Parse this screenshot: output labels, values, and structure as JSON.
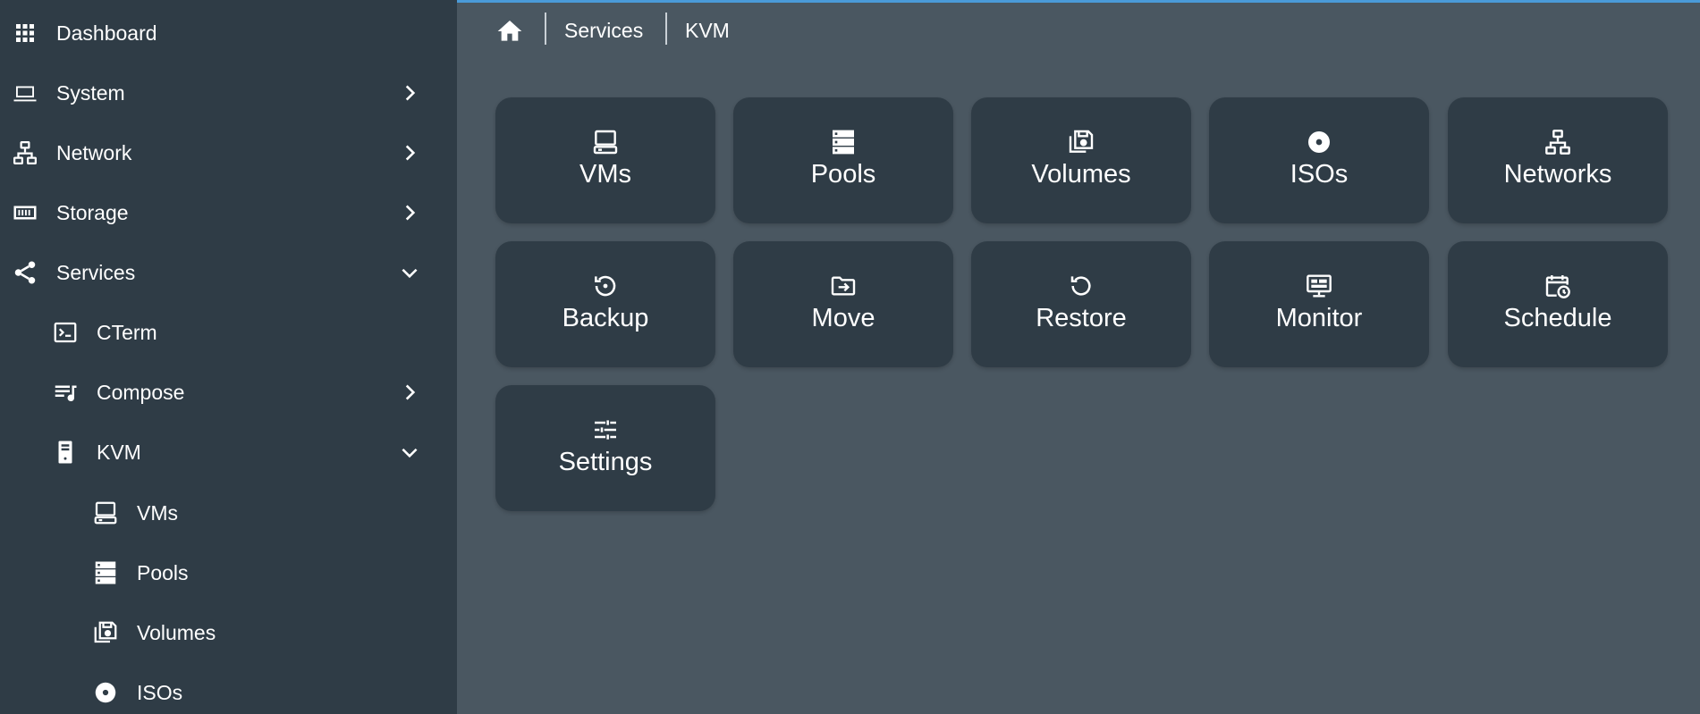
{
  "colors": {
    "sidebar_bg": "#2f3c46",
    "main_bg": "#4a5761",
    "tile_bg": "#2f3c46",
    "accent_line": "#4a9ad8",
    "text": "#ffffff"
  },
  "sidebar": {
    "items": [
      {
        "label": "Dashboard",
        "icon": "apps-grid-icon"
      },
      {
        "label": "System",
        "icon": "laptop-icon",
        "chevron": "right"
      },
      {
        "label": "Network",
        "icon": "network-icon",
        "chevron": "right"
      },
      {
        "label": "Storage",
        "icon": "storage-icon",
        "chevron": "right"
      },
      {
        "label": "Services",
        "icon": "share-icon",
        "chevron": "down"
      },
      {
        "label": "CTerm",
        "icon": "terminal-icon"
      },
      {
        "label": "Compose",
        "icon": "playlist-music-icon",
        "chevron": "right"
      },
      {
        "label": "KVM",
        "icon": "server-tower-icon",
        "chevron": "down"
      },
      {
        "label": "VMs",
        "icon": "desktop-tower-icon"
      },
      {
        "label": "Pools",
        "icon": "server-icon"
      },
      {
        "label": "Volumes",
        "icon": "floppy-multiple-icon"
      },
      {
        "label": "ISOs",
        "icon": "disc-icon"
      }
    ]
  },
  "breadcrumb": {
    "home_icon": "home-icon",
    "items": [
      "Services",
      "KVM"
    ]
  },
  "tiles": [
    {
      "label": "VMs",
      "icon": "desktop-tower-icon"
    },
    {
      "label": "Pools",
      "icon": "server-icon"
    },
    {
      "label": "Volumes",
      "icon": "floppy-multiple-icon"
    },
    {
      "label": "ISOs",
      "icon": "disc-icon"
    },
    {
      "label": "Networks",
      "icon": "network-icon"
    },
    {
      "label": "Backup",
      "icon": "backup-restore-icon"
    },
    {
      "label": "Move",
      "icon": "folder-move-icon"
    },
    {
      "label": "Restore",
      "icon": "restore-icon"
    },
    {
      "label": "Monitor",
      "icon": "monitor-dashboard-icon"
    },
    {
      "label": "Schedule",
      "icon": "calendar-clock-icon"
    },
    {
      "label": "Settings",
      "icon": "tune-icon"
    }
  ]
}
